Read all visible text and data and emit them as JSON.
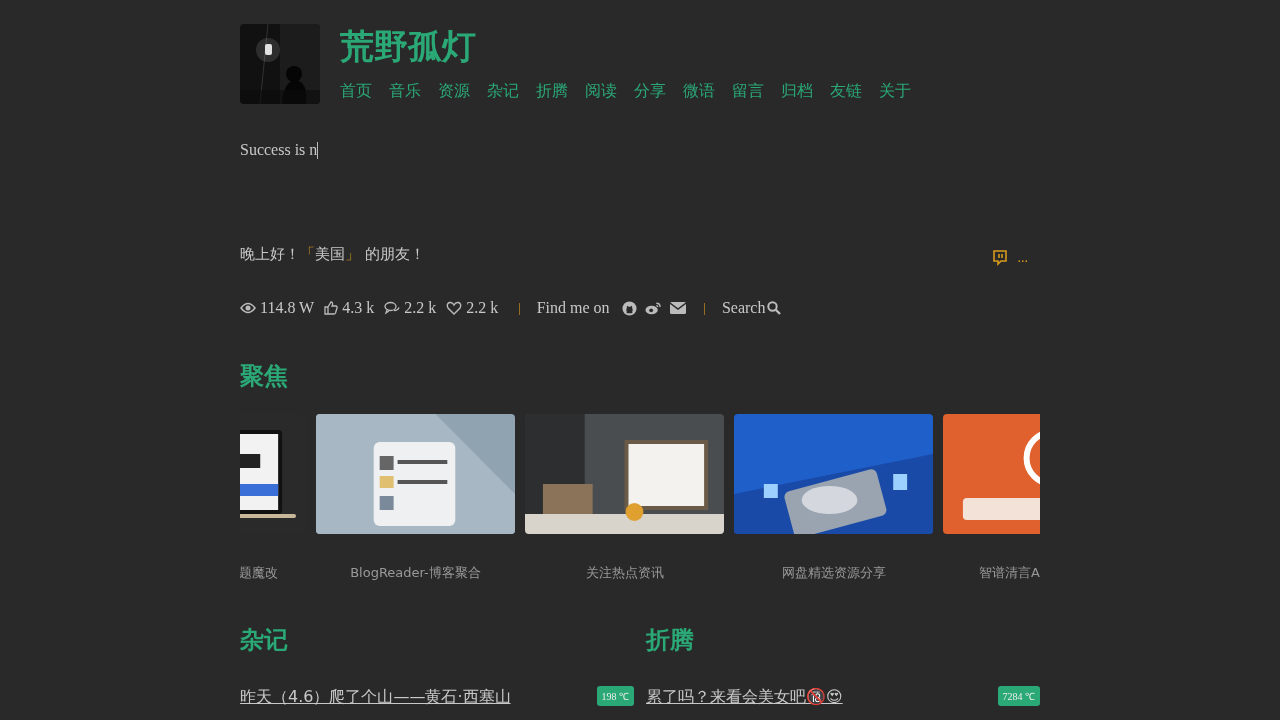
{
  "site": {
    "title": "荒野孤灯"
  },
  "nav": [
    {
      "label": "首页"
    },
    {
      "label": "音乐"
    },
    {
      "label": "资源"
    },
    {
      "label": "杂记"
    },
    {
      "label": "折腾"
    },
    {
      "label": "阅读"
    },
    {
      "label": "分享"
    },
    {
      "label": "微语"
    },
    {
      "label": "留言"
    },
    {
      "label": "归档"
    },
    {
      "label": "友链"
    },
    {
      "label": "关于"
    }
  ],
  "typing_text": "Success is n",
  "greeting": {
    "before": "晚上好！",
    "open": "「",
    "place": "美国",
    "close": "」",
    "after": " 的朋友！",
    "more": "..."
  },
  "stats": [
    {
      "kind": "views",
      "value": "114.8 W"
    },
    {
      "kind": "likes",
      "value": "4.3 k"
    },
    {
      "kind": "comments",
      "value": "2.2 k"
    },
    {
      "kind": "favorites",
      "value": "2.2 k"
    }
  ],
  "find_me": {
    "label": "Find me on",
    "links": [
      {
        "kind": "github"
      },
      {
        "kind": "weibo"
      },
      {
        "kind": "mail"
      }
    ]
  },
  "separators": [
    "|",
    "|"
  ],
  "search": {
    "label": "Search"
  },
  "focus": {
    "heading": "聚焦",
    "cards": [
      {
        "caption": "题魔改",
        "kind": "laptop"
      },
      {
        "caption": "BlogReader-博客聚合",
        "kind": "reader"
      },
      {
        "caption": "关注热点资讯",
        "kind": "room"
      },
      {
        "caption": "网盘精选资源分享",
        "kind": "disk"
      },
      {
        "caption": "智谱清言A",
        "kind": "orange"
      }
    ]
  },
  "sections": [
    {
      "heading": "杂记",
      "posts": [
        {
          "title": "昨天（4.6）爬了个山——黄石·西塞山",
          "heat": "198 ℃"
        }
      ]
    },
    {
      "heading": "折腾",
      "posts": [
        {
          "title": "累了吗？来看会美女吧🔞😍",
          "heat": "7284 ℃"
        }
      ]
    }
  ]
}
